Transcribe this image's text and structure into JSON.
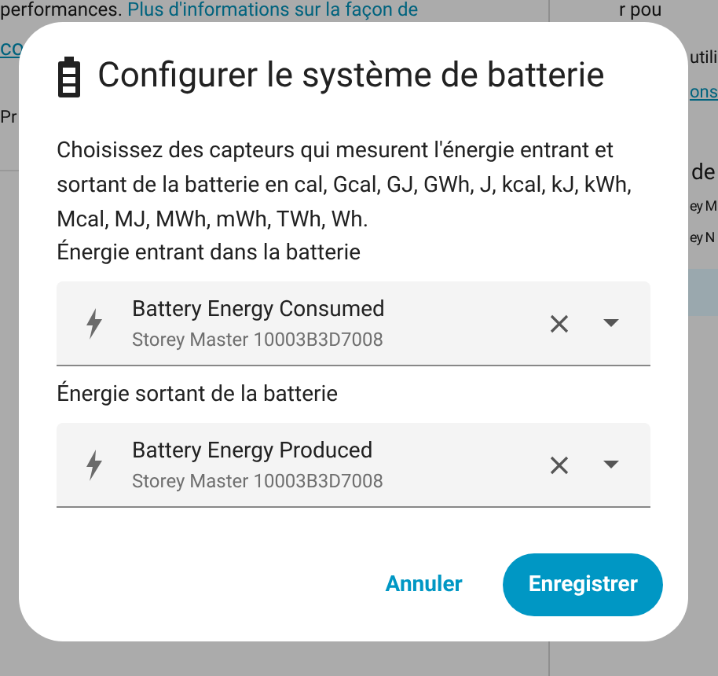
{
  "background": {
    "left": {
      "intro": "performances.",
      "intro_link": "Plus d'informations sur la façon de",
      "link_cont": "co",
      "heading": "Pr"
    },
    "right": {
      "lines": [
        "r pou",
        "utili"
      ],
      "link": "ons",
      "heading": "de",
      "items": [
        "ey M",
        "ey N"
      ]
    }
  },
  "dialog": {
    "title": "Configurer le système de batterie",
    "description": "Choisissez des capteurs qui mesurent l'énergie entrant et sortant de la batterie en cal, Gcal, GJ, GWh, J, kcal, kJ, kWh, Mcal, MJ, MWh, mWh, TWh, Wh.",
    "fields": [
      {
        "label": "Énergie entrant dans la batterie",
        "value": "Battery Energy Consumed",
        "secondary": "Storey Master 10003B3D7008"
      },
      {
        "label": "Énergie sortant de la batterie",
        "value": "Battery Energy Produced",
        "secondary": "Storey Master 10003B3D7008"
      }
    ],
    "buttons": [
      {
        "label": "Annuler",
        "kind": "text"
      },
      {
        "label": "Enregistrer",
        "kind": "filled"
      }
    ]
  }
}
